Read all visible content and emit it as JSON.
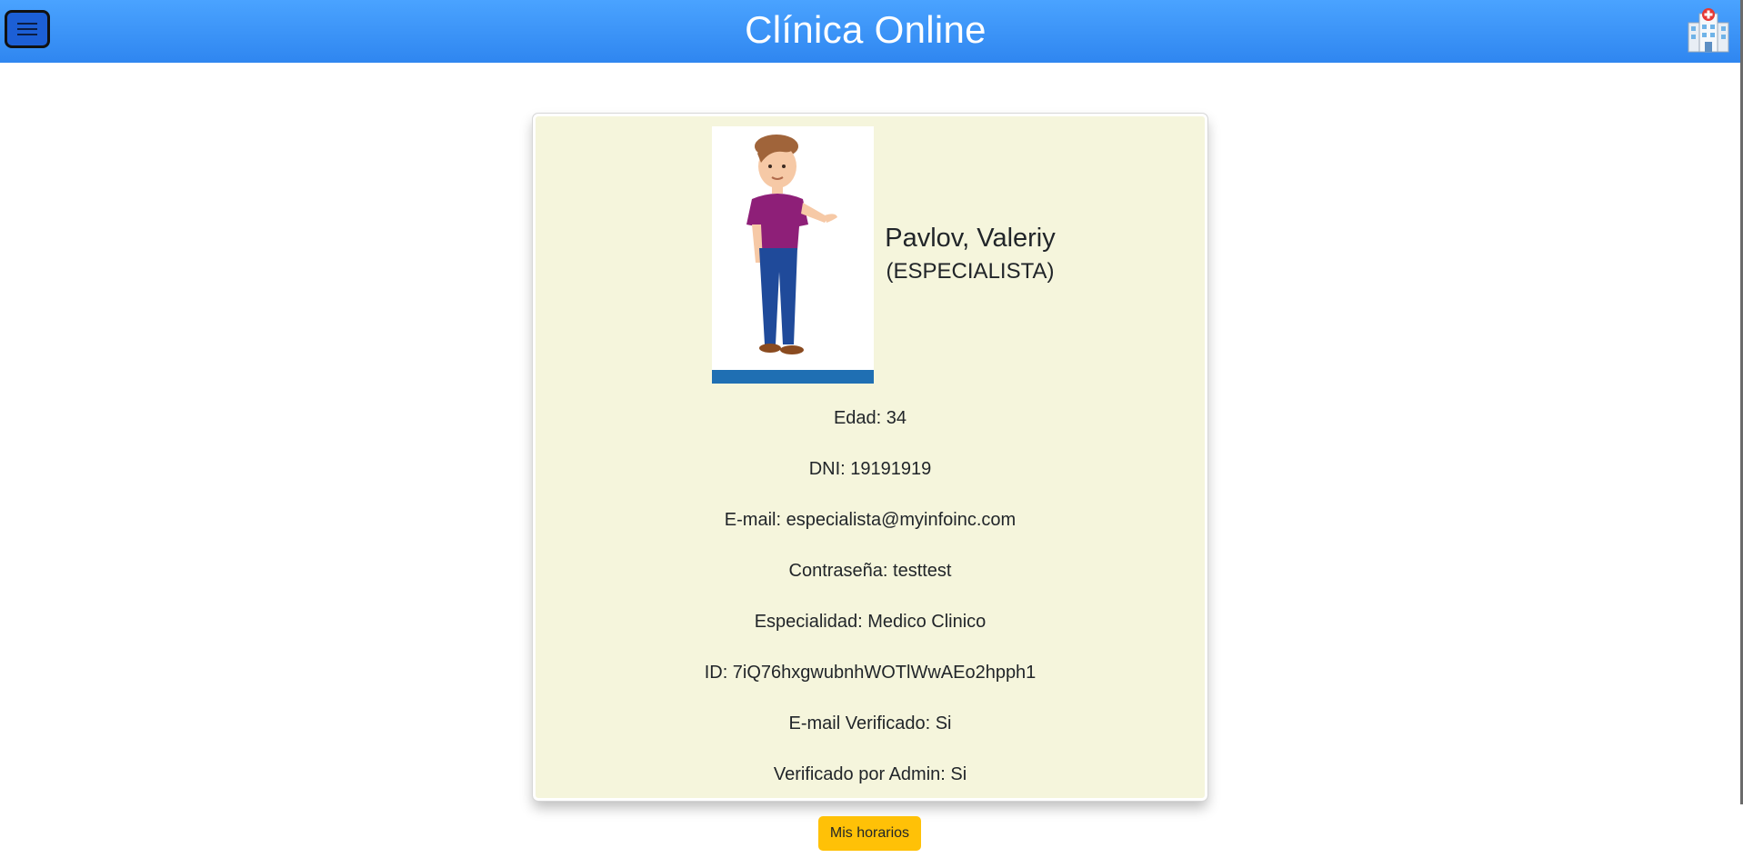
{
  "header": {
    "title": "Clínica Online",
    "menu_icon": "hamburger-menu-icon",
    "logo_icon": "hospital-icon"
  },
  "profile": {
    "name": "Pavlov, Valeriy",
    "role": "(ESPECIALISTA)",
    "avatar_image": "cartoon-man-avatar",
    "fields": [
      {
        "label": "Edad",
        "value": "34"
      },
      {
        "label": "DNI",
        "value": "19191919"
      },
      {
        "label": "E-mail",
        "value": "especialista@myinfoinc.com"
      },
      {
        "label": "Contraseña",
        "value": "testtest"
      },
      {
        "label": "Especialidad",
        "value": "Medico Clinico"
      },
      {
        "label": "ID",
        "value": "7iQ76hxgwubnhWOTlWwAEo2hpph1"
      },
      {
        "label": "E-mail Verificado",
        "value": "Si"
      },
      {
        "label": "Verificado por Admin",
        "value": "Si"
      }
    ],
    "field_lines": [
      "Edad: 34",
      "DNI: 19191919",
      "E-mail: especialista@myinfoinc.com",
      "Contraseña: testtest",
      "Especialidad: Medico Clinico",
      "ID: 7iQ76hxgwubnhWOTlWwAEo2hpph1",
      "E-mail Verificado: Si",
      "Verificado por Admin: Si"
    ]
  },
  "actions": {
    "horarios_label": "Mis horarios"
  },
  "colors": {
    "navbar": "#3a94f7",
    "card_background": "#f5f5dc",
    "button_warning": "#ffc107"
  }
}
